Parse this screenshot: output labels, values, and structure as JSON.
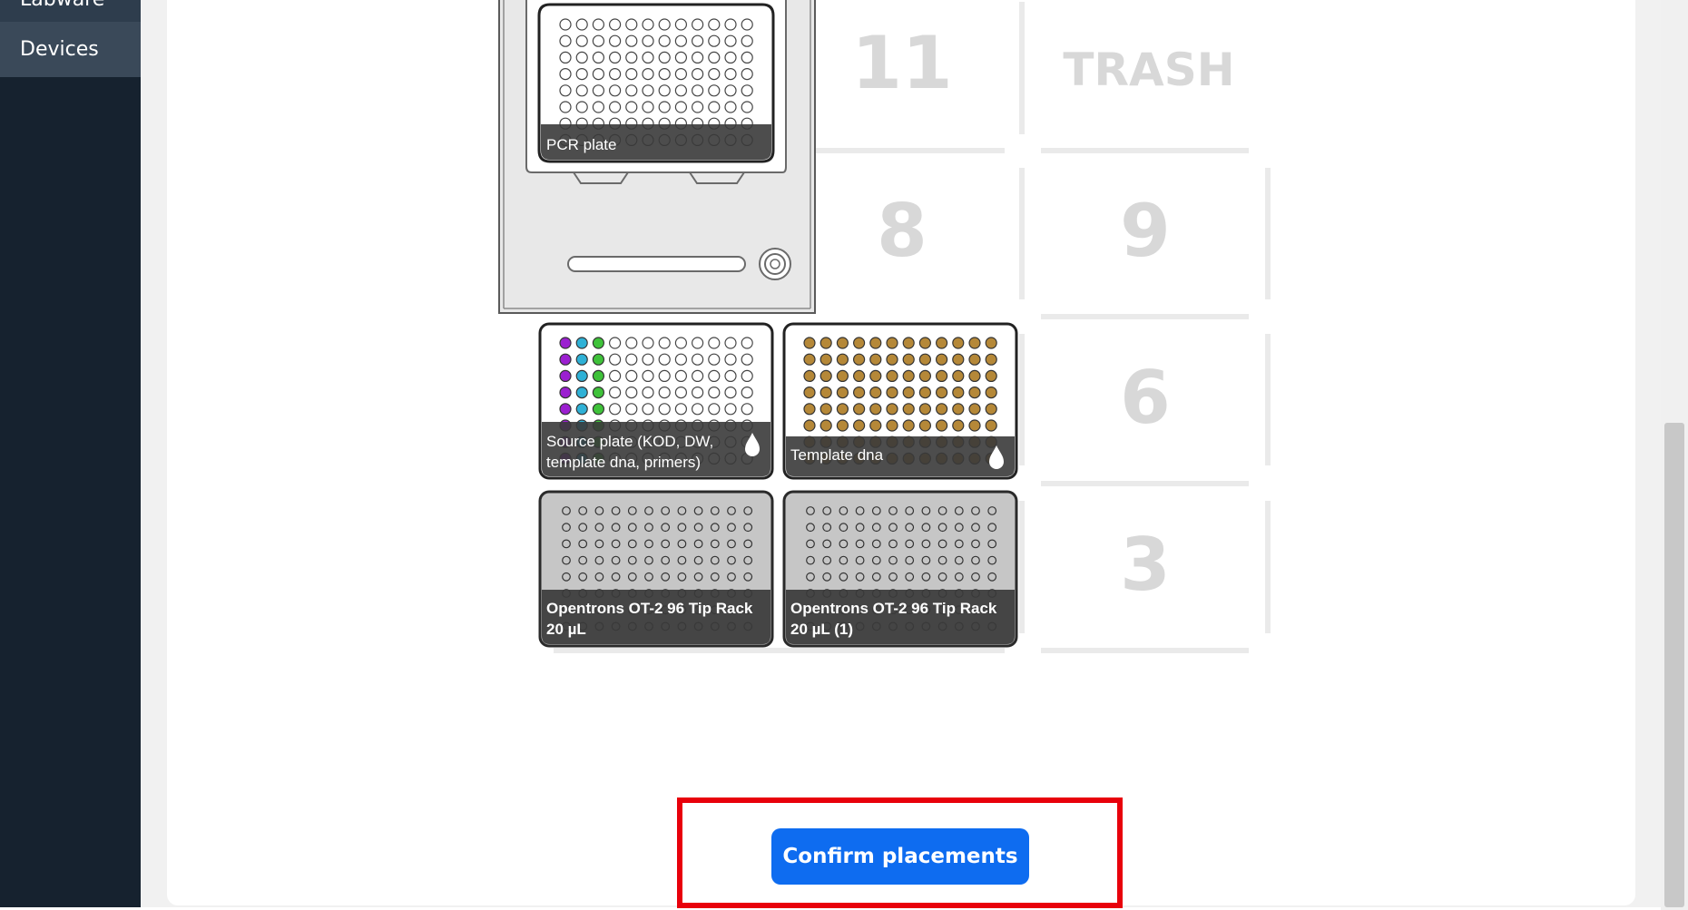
{
  "sidebar": {
    "items": [
      {
        "label": "Labware"
      },
      {
        "label": "Devices"
      }
    ]
  },
  "deck": {
    "slots": {
      "slot_11": "11",
      "slot_trash": "TRASH",
      "slot_8": "8",
      "slot_9": "9",
      "slot_6": "6",
      "slot_3": "3"
    },
    "labware": {
      "pcr_plate": "PCR plate",
      "source_line1": "Source plate (KOD, DW,",
      "source_line2": "template dna, primers)",
      "template": "Template dna",
      "tiprack1_line1": "Opentrons OT-2 96 Tip Rack",
      "tiprack1_line2": "20 µL",
      "tiprack2_line1": "Opentrons OT-2 96 Tip Rack",
      "tiprack2_line2": "20 µL (1)"
    }
  },
  "actions": {
    "confirm_label": "Confirm placements"
  },
  "colors": {
    "sidebar_bg": "#16222f",
    "primary": "#0e6cf0",
    "highlight": "#e8000b",
    "source_col1": "#9b1fd0",
    "source_col2": "#2fb1d6",
    "source_col3": "#3fc23a",
    "template_well": "#b58838"
  }
}
